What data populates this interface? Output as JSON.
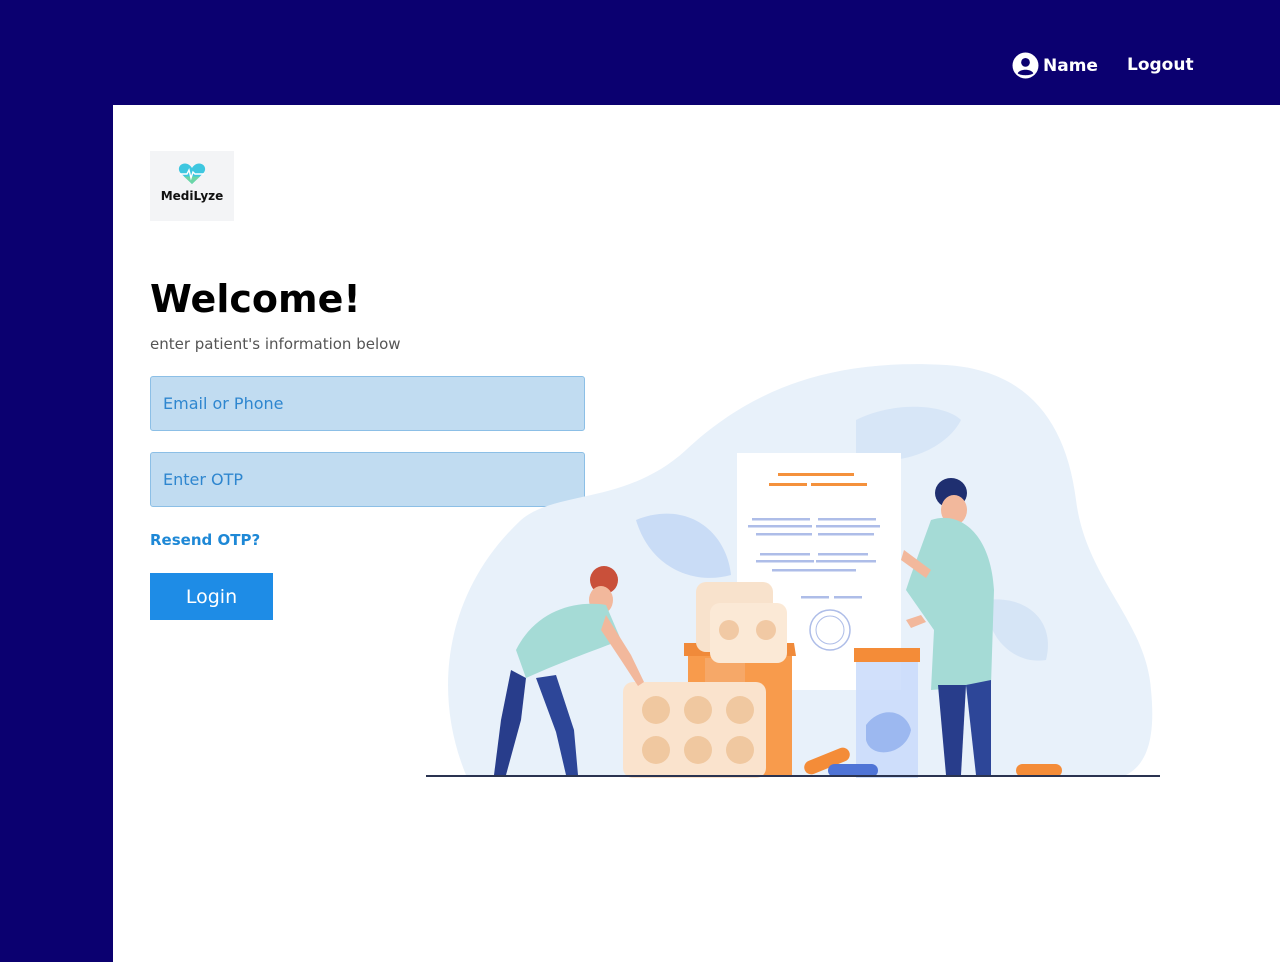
{
  "header": {
    "user_name": "Name",
    "logout_label": "Logout",
    "user_icon": "user-circle-icon"
  },
  "brand": {
    "name": "MediLyze",
    "icon": "heart-pulse-icon"
  },
  "form": {
    "title": "Welcome!",
    "subtitle": "enter patient's information below",
    "email_placeholder": "Email or Phone",
    "otp_placeholder": "Enter OTP",
    "resend_label": "Resend OTP?",
    "login_label": "Login"
  },
  "colors": {
    "nav_background": "#0b0070",
    "primary_button": "#1e8ce6",
    "input_background": "#c1dcf1",
    "link": "#1e88d6"
  }
}
